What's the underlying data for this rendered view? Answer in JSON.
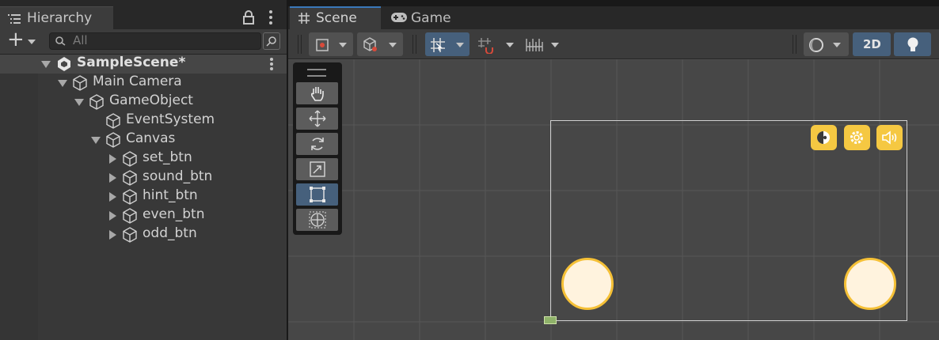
{
  "hierarchy": {
    "tab_label": "Hierarchy",
    "add_label": "+",
    "search_placeholder": "All",
    "scene_name": "SampleScene*",
    "items": [
      {
        "label": "Main Camera"
      },
      {
        "label": "GameObject"
      },
      {
        "label": "EventSystem"
      },
      {
        "label": "Canvas"
      },
      {
        "label": "set_btn"
      },
      {
        "label": "sound_btn"
      },
      {
        "label": "hint_btn"
      },
      {
        "label": "even_btn"
      },
      {
        "label": "odd_btn"
      }
    ]
  },
  "scene": {
    "tabs": [
      {
        "label": "Scene",
        "icon": "hash-icon"
      },
      {
        "label": "Game",
        "icon": "gamepad-icon"
      }
    ],
    "mode_2d_label": "2D"
  },
  "colors": {
    "accent": "#3a79bb",
    "button_yellow": "#f5c842",
    "button_fill": "#fff3de",
    "active_tool": "#46607c"
  }
}
